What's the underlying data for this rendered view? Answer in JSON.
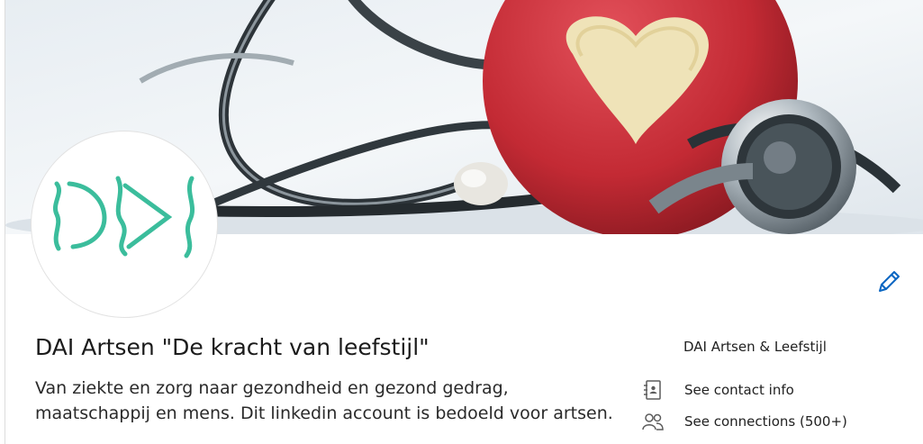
{
  "profile": {
    "name": "DAI Artsen \"De kracht van leefstijl\"",
    "headline": "Van ziekte en zorg naar gezondheid en gezond gedrag, maatschappij en mens. Dit linkedin account is bedoeld voor artsen.",
    "logo_text": "DAI",
    "company": "DAI Artsen & Leefstijl",
    "contact_info_label": "See contact info",
    "connections_label": "See connections (500+)"
  },
  "icons": {
    "edit": "pencil-icon",
    "contact": "contact-card-icon",
    "connections": "people-icon"
  },
  "colors": {
    "accent": "#0a66c2",
    "logo": "#3bbd9c",
    "banner_apple": "#c8303a"
  }
}
